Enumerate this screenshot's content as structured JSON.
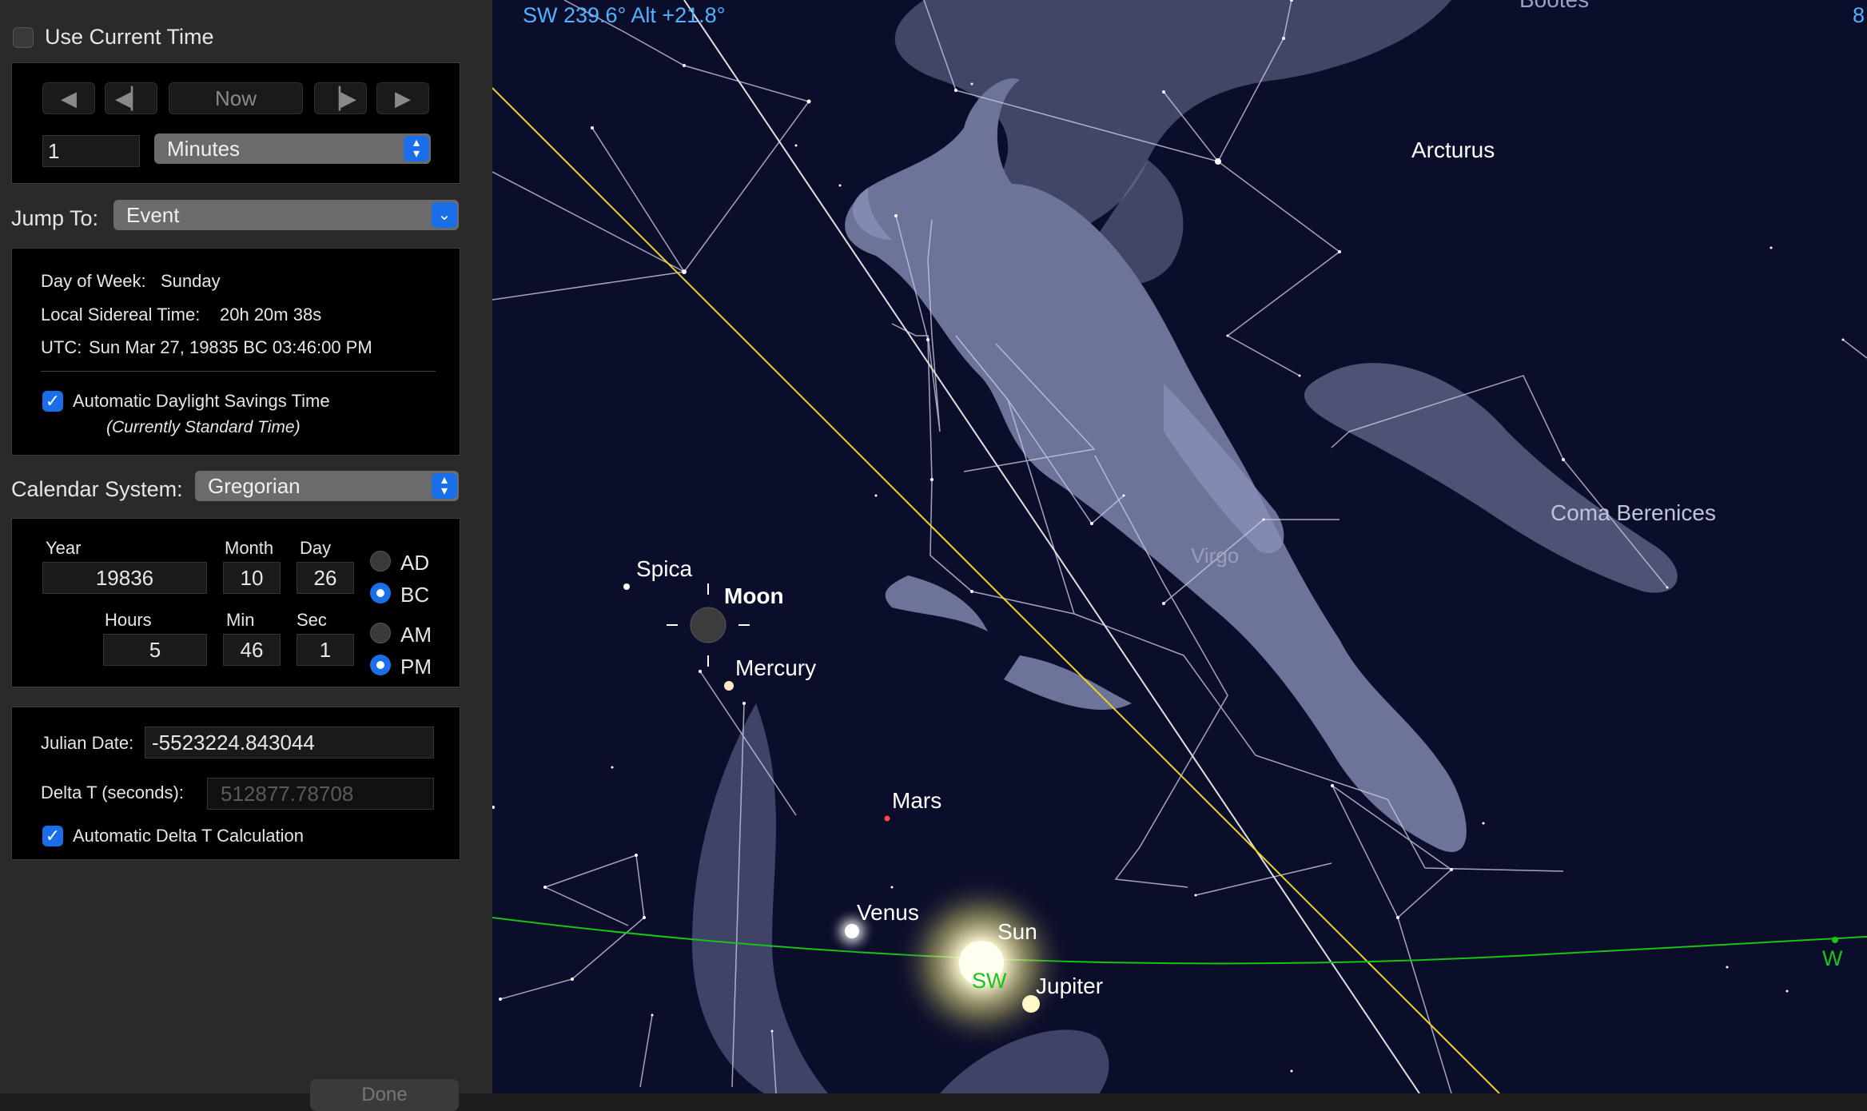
{
  "sidebar": {
    "use_current_time": {
      "label": "Use Current Time",
      "checked": false
    },
    "nav": {
      "now_label": "Now",
      "step_value": "1",
      "step_unit": "Minutes"
    },
    "jump_to": {
      "label": "Jump To:",
      "value": "Event"
    },
    "info": {
      "day_of_week_label": "Day of Week:",
      "day_of_week_value": "Sunday",
      "sidereal_label": "Local Sidereal Time:",
      "sidereal_value": "20h 20m 38s",
      "utc_label": "UTC:",
      "utc_value": "Sun Mar 27, 19835 BC 03:46:00 PM",
      "dst_label": "Automatic Daylight Savings Time",
      "dst_checked": true,
      "dst_note": "(Currently Standard Time)"
    },
    "calendar": {
      "label": "Calendar System:",
      "value": "Gregorian"
    },
    "datetime": {
      "year_label": "Year",
      "year": "19836",
      "month_label": "Month",
      "month": "10",
      "day_label": "Day",
      "day": "26",
      "hours_label": "Hours",
      "hours": "5",
      "min_label": "Min",
      "min": "46",
      "sec_label": "Sec",
      "sec": "1",
      "ad_label": "AD",
      "bc_label": "BC",
      "era": "BC",
      "am_label": "AM",
      "pm_label": "PM",
      "ampm": "PM"
    },
    "julian": {
      "julian_label": "Julian Date:",
      "julian_value": "-5523224.843044",
      "delta_label": "Delta T (seconds):",
      "delta_value": "512877.78708",
      "auto_delta_label": "Automatic Delta T Calculation",
      "auto_delta_checked": true
    },
    "done_label": "Done"
  },
  "sky": {
    "readout": "SW 239.6° Alt +21.8°",
    "labels": {
      "bootes": "Bootes",
      "arcturus": "Arcturus",
      "coma": "Coma Berenices",
      "virgo": "Virgo",
      "spica": "Spica",
      "moon": "Moon",
      "mercury": "Mercury",
      "mars": "Mars",
      "venus": "Venus",
      "sun": "Sun",
      "jupiter": "Jupiter",
      "sw": "SW",
      "w": "W",
      "edge_fragment": "8"
    },
    "colors": {
      "sky": "#0b0e2a",
      "ecliptic": "#e6d629",
      "horizon": "#18c418",
      "readout": "#4fb3ff"
    }
  }
}
